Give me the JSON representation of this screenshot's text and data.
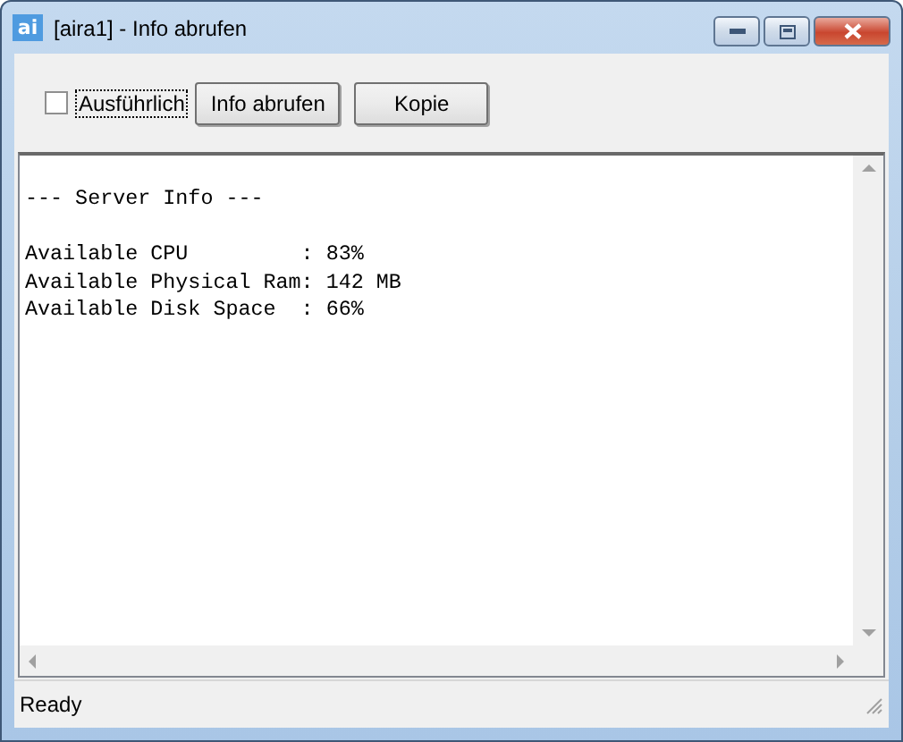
{
  "window": {
    "icon_text": "ai",
    "title": "[aira1] - Info abrufen"
  },
  "toolbar": {
    "checkbox": {
      "label": "Ausführlich",
      "checked": false,
      "focused": true
    },
    "buttons": [
      "Info abrufen",
      "Kopie"
    ]
  },
  "output": {
    "lines": [
      {
        "text": "--- Server Info ---",
        "blank_before": true
      },
      {
        "text": "Available CPU         : 83%",
        "blank_before": true
      },
      {
        "text": "Available Physical Ram: 142 MB",
        "blank_before": false
      },
      {
        "text": "Available Disk Space  : 66%",
        "blank_before": false
      }
    ]
  },
  "status_bar": "Ready"
}
